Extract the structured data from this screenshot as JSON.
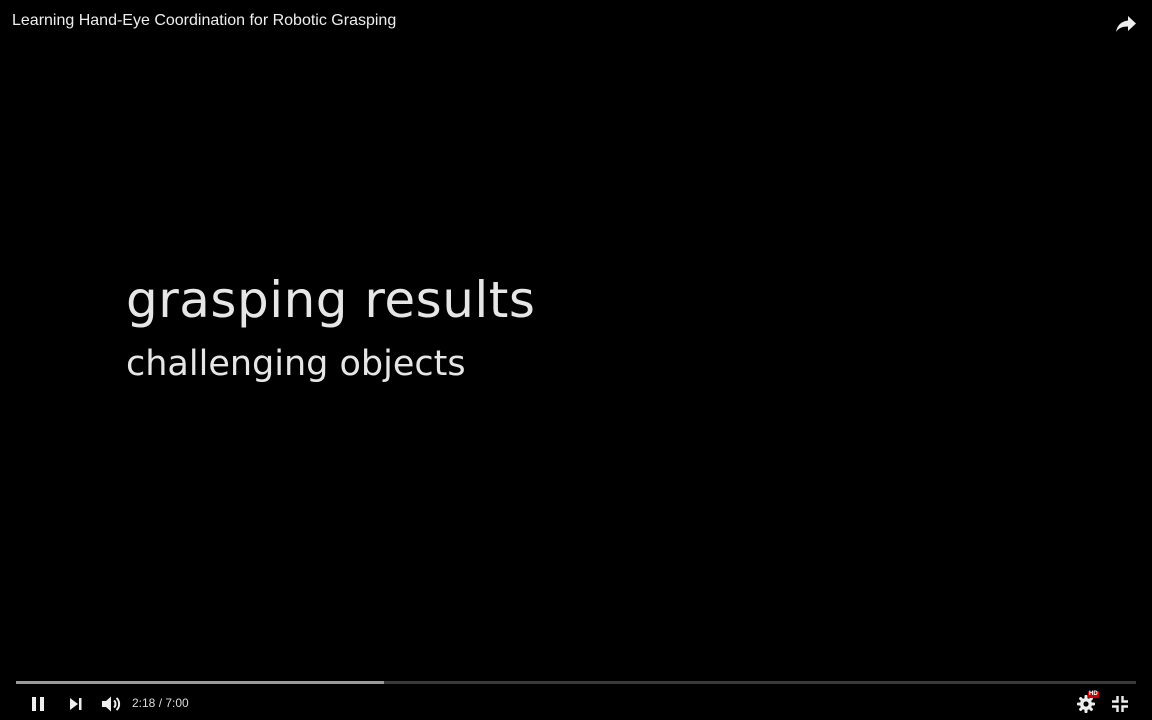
{
  "player": {
    "video_title": "Learning Hand-Eye Coordination for Robotic Grasping",
    "icons": {
      "share": "share-icon",
      "pause": "pause-icon",
      "next": "next-icon",
      "volume": "volume-icon",
      "settings": "gear-icon",
      "exit_fullscreen": "exit-fullscreen-icon"
    },
    "settings_badge": "HD"
  },
  "slide": {
    "heading": "grasping results",
    "subheading": "challenging objects"
  },
  "playback": {
    "current_time": "2:18",
    "duration": "7:00",
    "time_display": "2:18 / 7:00",
    "progress_fraction": 0.3286
  },
  "colors": {
    "background": "#000000",
    "text": "#e6e6e6",
    "progress_played": "#9a9a9a",
    "progress_track": "#3a3a3a",
    "hd_badge": "#cc0000"
  }
}
